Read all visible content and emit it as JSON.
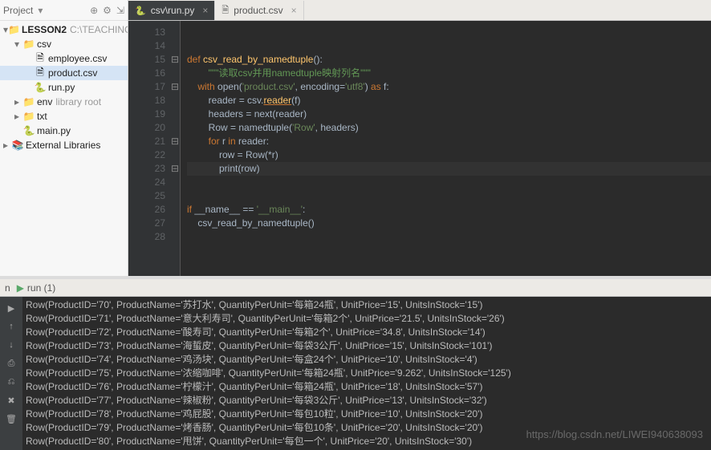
{
  "sidebar": {
    "title": "Project",
    "tools": [
      "⊕",
      "⚙",
      "⇲"
    ],
    "nodes": [
      {
        "indent": 0,
        "tw": "▾",
        "icon": "📁",
        "label": "LESSON2",
        "hint": "C:\\TEACHING\\PY\\",
        "bold": true
      },
      {
        "indent": 1,
        "tw": "▾",
        "icon": "📁",
        "label": "csv",
        "hint": ""
      },
      {
        "indent": 2,
        "tw": "",
        "icon": "🗎",
        "label": "employee.csv",
        "hint": ""
      },
      {
        "indent": 2,
        "tw": "",
        "icon": "🗎",
        "label": "product.csv",
        "hint": "",
        "selected": true
      },
      {
        "indent": 2,
        "tw": "",
        "icon": "🐍",
        "label": "run.py",
        "hint": ""
      },
      {
        "indent": 1,
        "tw": "▸",
        "icon": "📁",
        "label": "env",
        "hint": "library root"
      },
      {
        "indent": 1,
        "tw": "▸",
        "icon": "📁",
        "label": "txt",
        "hint": ""
      },
      {
        "indent": 1,
        "tw": "",
        "icon": "🐍",
        "label": "main.py",
        "hint": ""
      },
      {
        "indent": 0,
        "tw": "▸",
        "icon": "📚",
        "label": "External Libraries",
        "hint": ""
      }
    ]
  },
  "tabs": [
    {
      "icon": "🐍",
      "label": "csv\\run.py",
      "close": "×",
      "active": true
    },
    {
      "icon": "🗎",
      "label": "product.csv",
      "close": "×",
      "active": false
    }
  ],
  "code_start_line": 13,
  "code_lines": [
    {
      "html": ""
    },
    {
      "html": ""
    },
    {
      "html": "<span class='kw'>def</span> <span class='fn'>csv_read_by_namedtuple</span>():"
    },
    {
      "html": "        <span class='str-doc'>\"\"\"读取csv并用namedtuple映射列名\"\"\"</span>"
    },
    {
      "html": "    <span class='kw'>with</span> open(<span class='str'>'product.csv'</span>, <span class='op'>encoding</span>=<span class='str'>'utf8'</span>) <span class='kw'>as</span> f:"
    },
    {
      "html": "        reader = csv.<span class='fn ul'>reader</span>(f)"
    },
    {
      "html": "        headers = next(reader)"
    },
    {
      "html": "        Row = namedtuple(<span class='str'>'Row'</span>, headers)"
    },
    {
      "html": "        <span class='kw'>for</span> r <span class='kw'>in</span> reader:"
    },
    {
      "html": "            row = Row(*r)"
    },
    {
      "html": "            print(row)",
      "hl": true
    },
    {
      "html": ""
    },
    {
      "html": ""
    },
    {
      "html": "<span class='kw'>if</span> __name__ == <span class='str'>'__main__'</span>:"
    },
    {
      "html": "    csv_read_by_namedtuple()"
    },
    {
      "html": ""
    }
  ],
  "fold_marks": {
    "15": "⊟",
    "17": "⊟",
    "21": "⊟",
    "23": "⊟"
  },
  "run_tab": {
    "icon": "▶",
    "label": "run (1)"
  },
  "run_sidebar": [
    "▶",
    "↑",
    "↓",
    "⎙",
    "⎌",
    "✖",
    "🗑"
  ],
  "output_lines": [
    "Row(ProductID='70', ProductName='苏打水', QuantityPerUnit='每箱24瓶', UnitPrice='15', UnitsInStock='15')",
    "Row(ProductID='71', ProductName='意大利寿司', QuantityPerUnit='每箱2个', UnitPrice='21.5', UnitsInStock='26')",
    "Row(ProductID='72', ProductName='酸寿司', QuantityPerUnit='每箱2个', UnitPrice='34.8', UnitsInStock='14')",
    "Row(ProductID='73', ProductName='海蜇皮', QuantityPerUnit='每袋3公斤', UnitPrice='15', UnitsInStock='101')",
    "Row(ProductID='74', ProductName='鸡汤块', QuantityPerUnit='每盒24个', UnitPrice='10', UnitsInStock='4')",
    "Row(ProductID='75', ProductName='浓缩咖啡', QuantityPerUnit='每箱24瓶', UnitPrice='9.262', UnitsInStock='125')",
    "Row(ProductID='76', ProductName='柠檬汁', QuantityPerUnit='每箱24瓶', UnitPrice='18', UnitsInStock='57')",
    "Row(ProductID='77', ProductName='辣椒粉', QuantityPerUnit='每袋3公斤', UnitPrice='13', UnitsInStock='32')",
    "Row(ProductID='78', ProductName='鸡屁股', QuantityPerUnit='每包10粒', UnitPrice='10', UnitsInStock='20')",
    "Row(ProductID='79', ProductName='烤香肠', QuantityPerUnit='每包10条', UnitPrice='20', UnitsInStock='20')",
    "Row(ProductID='80', ProductName='甩饼', QuantityPerUnit='每包一个', UnitPrice='20', UnitsInStock='30')"
  ],
  "watermark": "https://blog.csdn.net/LIWEI940638093"
}
